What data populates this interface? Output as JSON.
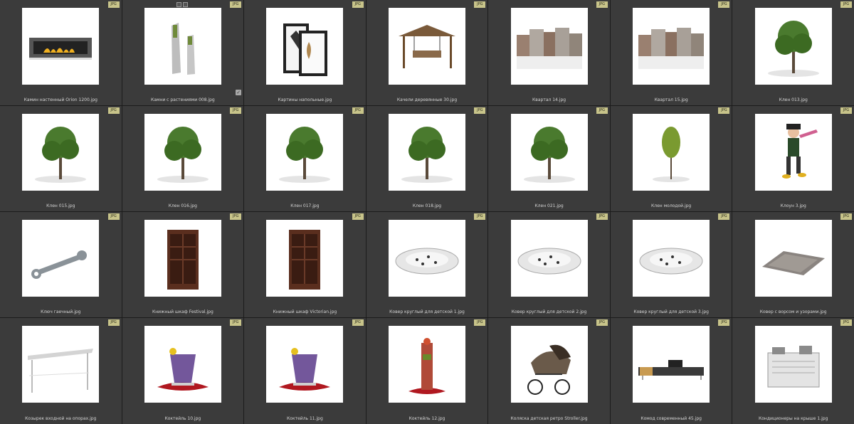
{
  "grid": {
    "items": [
      {
        "filename": "Камин настенный Orion 1200.jpg",
        "badge": "JPG",
        "icon": "fireplace-thumbnail"
      },
      {
        "filename": "Камни с растениями 008.jpg",
        "badge": "JPG",
        "icon": "stones-thumbnail",
        "selected": true
      },
      {
        "filename": "Картины напольные.jpg",
        "badge": "JPG",
        "icon": "paintings-thumbnail"
      },
      {
        "filename": "Качели деревянные 30.jpg",
        "badge": "JPG",
        "icon": "swing-thumbnail"
      },
      {
        "filename": "Квартал 14.jpg",
        "badge": "JPG",
        "icon": "city-block-thumbnail"
      },
      {
        "filename": "Квартал 15.jpg",
        "badge": "JPG",
        "icon": "city-block-thumbnail"
      },
      {
        "filename": "Клен 013.jpg",
        "badge": "JPG",
        "icon": "tree-thumbnail"
      },
      {
        "filename": "Клен 015.jpg",
        "badge": "JPG",
        "icon": "tree-thumbnail"
      },
      {
        "filename": "Клен 016.jpg",
        "badge": "JPG",
        "icon": "tree-thumbnail"
      },
      {
        "filename": "Клен 017.jpg",
        "badge": "JPG",
        "icon": "tree-thumbnail"
      },
      {
        "filename": "Клен 018.jpg",
        "badge": "JPG",
        "icon": "tree-thumbnail"
      },
      {
        "filename": "Клен 021.jpg",
        "badge": "JPG",
        "icon": "tree-thumbnail"
      },
      {
        "filename": "Клен молодой.jpg",
        "badge": "JPG",
        "icon": "young-tree-thumbnail"
      },
      {
        "filename": "Клоун 3.jpg",
        "badge": "JPG",
        "icon": "clown-thumbnail"
      },
      {
        "filename": "Ключ гаечный.jpg",
        "badge": "JPG",
        "icon": "wrench-thumbnail"
      },
      {
        "filename": "Книжный шкаф Festival.jpg",
        "badge": "JPG",
        "icon": "bookcase-thumbnail"
      },
      {
        "filename": "Книжный шкаф Victorian.jpg",
        "badge": "JPG",
        "icon": "bookcase-thumbnail"
      },
      {
        "filename": "Ковер круглый для детской 1.jpg",
        "badge": "JPG",
        "icon": "round-rug-thumbnail"
      },
      {
        "filename": "Ковер круглый для детской 2.jpg",
        "badge": "JPG",
        "icon": "round-rug-thumbnail"
      },
      {
        "filename": "Ковер круглый для детской 3.jpg",
        "badge": "JPG",
        "icon": "round-rug-thumbnail"
      },
      {
        "filename": "Ковер с ворсом и узорами.jpg",
        "badge": "JPG",
        "icon": "rug-thumbnail"
      },
      {
        "filename": "Козырек входной на опорах.jpg",
        "badge": "JPG",
        "icon": "canopy-thumbnail"
      },
      {
        "filename": "Коктейль 10.jpg",
        "badge": "JPG",
        "icon": "cocktail-thumbnail"
      },
      {
        "filename": "Коктейль 11.jpg",
        "badge": "JPG",
        "icon": "cocktail-thumbnail"
      },
      {
        "filename": "Коктейль 12.jpg",
        "badge": "JPG",
        "icon": "tall-cocktail-thumbnail"
      },
      {
        "filename": "Коляска детская ретро Stroller.jpg",
        "badge": "JPG",
        "icon": "stroller-thumbnail"
      },
      {
        "filename": "Комод современный 45.jpg",
        "badge": "JPG",
        "icon": "tv-stand-thumbnail"
      },
      {
        "filename": "Кондиционеры на крыше 1.jpg",
        "badge": "JPG",
        "icon": "air-conditioner-thumbnail"
      }
    ]
  },
  "colors": {
    "background": "#1b1b1b",
    "cell": "#3b3b3b",
    "badge": "#c8c48a",
    "text": "#d4d4d4"
  }
}
